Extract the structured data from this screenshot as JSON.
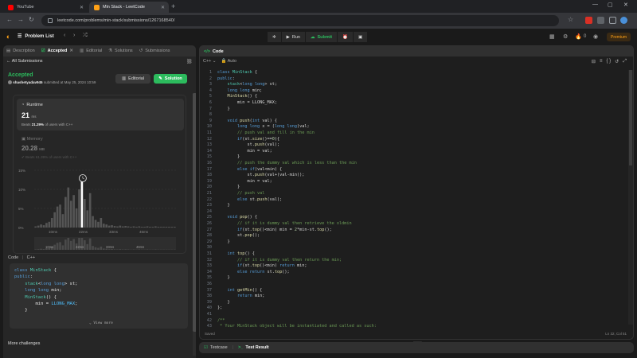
{
  "browser": {
    "tabs": [
      {
        "title": "YouTube"
      },
      {
        "title": "Min Stack - LeetCode"
      }
    ],
    "url": "leetcode.com/problems/min-stack/submissions/1267168540/"
  },
  "header": {
    "problem_list": "Problem List",
    "run": "Run",
    "submit": "Submit",
    "streak": "0",
    "premium": "Premium"
  },
  "left": {
    "tabs": [
      {
        "label": "Description"
      },
      {
        "label": "Accepted"
      },
      {
        "label": "Editorial"
      },
      {
        "label": "Solutions"
      },
      {
        "label": "Submissions"
      }
    ],
    "all_submissions": "All Submissions",
    "status": "Accepted",
    "user": "shashetyadav945",
    "submitted_at": "submitted at May 25, 2024 10:59",
    "editorial_btn": "Editorial",
    "solution_btn": "Solution",
    "runtime": {
      "title": "Runtime",
      "value": "21",
      "unit": "ms",
      "beats_label": "Beats",
      "beats_pct": "21.29%",
      "beats_suffix": "of users with C++"
    },
    "memory": {
      "title": "Memory",
      "value": "20.28",
      "unit": "MB",
      "beats_label": "Beats",
      "beats_pct": "61.39%",
      "beats_suffix": "of users with C++"
    },
    "code_header": "Code",
    "code_lang": "C++",
    "code_lines": [
      "class MinStack {",
      "public:",
      "    stack<long long> st;",
      "    long long min;",
      "    MinStack() {",
      "        min = LLONG_MAX;",
      "    }"
    ],
    "view_more": "View more",
    "more_challenges": "More challenges"
  },
  "chart_data": {
    "type": "bar",
    "y_ticks": [
      "15%",
      "10%",
      "5%",
      "0%"
    ],
    "x_ticks": [
      "10ms",
      "22ms",
      "33ms",
      "46ms"
    ],
    "mini_x_ticks": [
      "10ms",
      "22ms",
      "33ms",
      "46ms"
    ],
    "ylim": [
      0,
      15
    ],
    "highlight_value": "21ms",
    "values": [
      0.3,
      0.5,
      0.8,
      0.6,
      1.2,
      1.5,
      2.5,
      4.0,
      5.5,
      6.0,
      3.5,
      8.0,
      10.5,
      7.0,
      8.5,
      5.0,
      10.0,
      12.5,
      7.5,
      4.5,
      9.0,
      3.0,
      2.0,
      1.5,
      2.5,
      1.0,
      0.8,
      0.5,
      0.6,
      0.4,
      0.3,
      0.5,
      0.3,
      0.4,
      0.3,
      0.2,
      0.3,
      0.2,
      0.3,
      0.2,
      0.2,
      0.3,
      0.2,
      0.2,
      0.3,
      0.2,
      0.2,
      0.2,
      0.2,
      0.2,
      0.2,
      0.2
    ],
    "highlight_index": 17
  },
  "editor": {
    "title": "Code",
    "lang": "C++",
    "autosave": "Auto",
    "saved": "Saved",
    "cursor": "Ln 32, Col 51",
    "lines": [
      {
        "n": "1",
        "h": "<span class=\"kw\">class</span> <span class=\"ty\">MinStack</span> {"
      },
      {
        "n": "2",
        "h": "<span class=\"kw\">public</span>:"
      },
      {
        "n": "3",
        "h": "    <span class=\"ty\">stack</span>&lt;<span class=\"kw\">long long</span>&gt; st;"
      },
      {
        "n": "4",
        "h": "    <span class=\"kw\">long long</span> min;"
      },
      {
        "n": "5",
        "h": "    <span class=\"fn\">MinStack</span>() {"
      },
      {
        "n": "6",
        "h": "        min = LLONG_MAX;"
      },
      {
        "n": "7",
        "h": "    }"
      },
      {
        "n": "8",
        "h": ""
      },
      {
        "n": "9",
        "h": "    <span class=\"kw\">void</span> <span class=\"fn\">push</span>(<span class=\"kw\">int</span> val) {"
      },
      {
        "n": "10",
        "h": "        <span class=\"kw\">long long</span> x = (<span class=\"kw\">long long</span>)val;"
      },
      {
        "n": "11",
        "h": "        <span class=\"cm\">// push val and fill in the min</span>"
      },
      {
        "n": "12",
        "h": "        <span class=\"kw\">if</span>(st.<span class=\"fn\">size</span>()==<span class=\"nm\">0</span>){"
      },
      {
        "n": "13",
        "h": "            st.<span class=\"fn\">push</span>(val);"
      },
      {
        "n": "14",
        "h": "            min = val;"
      },
      {
        "n": "15",
        "h": "        }"
      },
      {
        "n": "16",
        "h": "        <span class=\"cm\">// push the dummy val which is less than the min</span>"
      },
      {
        "n": "17",
        "h": "        <span class=\"kw\">else if</span>(val&lt;min) {"
      },
      {
        "n": "18",
        "h": "            st.<span class=\"fn\">push</span>(val+(val-min));"
      },
      {
        "n": "19",
        "h": "            min = val;"
      },
      {
        "n": "20",
        "h": "        }"
      },
      {
        "n": "21",
        "h": "        <span class=\"cm\">// push val</span>"
      },
      {
        "n": "22",
        "h": "        <span class=\"kw\">else</span> st.<span class=\"fn\">push</span>(val);"
      },
      {
        "n": "23",
        "h": "    }"
      },
      {
        "n": "24",
        "h": ""
      },
      {
        "n": "25",
        "h": "    <span class=\"kw\">void</span> <span class=\"fn\">pop</span>() {"
      },
      {
        "n": "26",
        "h": "        <span class=\"cm\">// if it is dummy val then retrieve the oldmin</span>"
      },
      {
        "n": "27",
        "h": "        <span class=\"kw\">if</span>(st.<span class=\"fn\">top</span>()&lt;min) min = <span class=\"nm\">2</span>*min-st.<span class=\"fn\">top</span>();"
      },
      {
        "n": "28",
        "h": "        st.<span class=\"fn\">pop</span>();"
      },
      {
        "n": "29",
        "h": "    }"
      },
      {
        "n": "30",
        "h": ""
      },
      {
        "n": "31",
        "h": "    <span class=\"kw\">int</span> <span class=\"fn\">top</span>() {"
      },
      {
        "n": "32",
        "h": "        <span class=\"cm\">// if it is dummy val then return the min;</span>"
      },
      {
        "n": "33",
        "h": "        <span class=\"kw\">if</span>(st.<span class=\"fn\">top</span>()&lt;min) <span class=\"kw\">return</span> min;"
      },
      {
        "n": "34",
        "h": "        <span class=\"kw\">else return</span> st.<span class=\"fn\">top</span>();"
      },
      {
        "n": "35",
        "h": "    }"
      },
      {
        "n": "36",
        "h": ""
      },
      {
        "n": "37",
        "h": "    <span class=\"kw\">int</span> <span class=\"fn\">getMin</span>() {"
      },
      {
        "n": "38",
        "h": "        <span class=\"kw\">return</span> min;"
      },
      {
        "n": "39",
        "h": "    }"
      },
      {
        "n": "40",
        "h": "};"
      },
      {
        "n": "41",
        "h": ""
      },
      {
        "n": "42",
        "h": "<span class=\"cm\">/**</span>"
      },
      {
        "n": "43",
        "h": "<span class=\"cm\"> * Your MinStack object will be instantiated and called as such:</span>"
      }
    ]
  },
  "bottom": {
    "testcase": "Testcase",
    "test_result": "Test Result"
  }
}
